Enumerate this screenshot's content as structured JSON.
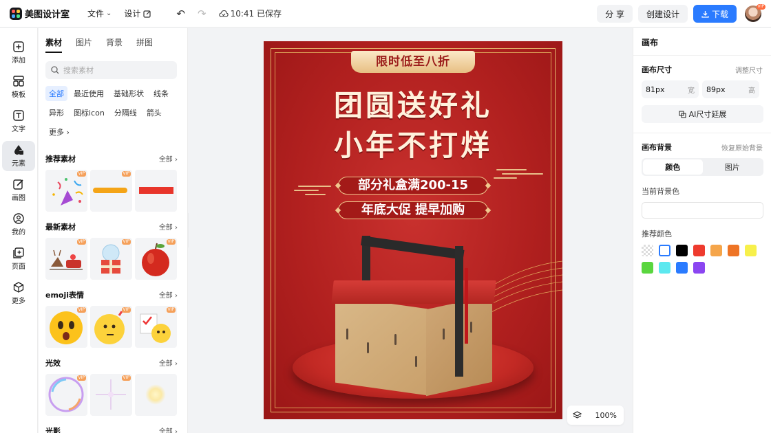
{
  "app": {
    "name": "美图设计室"
  },
  "topbar": {
    "file_menu": "文件",
    "design_menu": "设计",
    "save_status": "10:41 已保存",
    "share_label": "分 享",
    "create_label": "创建设计",
    "download_label": "下载",
    "avatar_badge": "VIP"
  },
  "rail": {
    "items": [
      {
        "label": "添加",
        "icon": "plus-square-icon"
      },
      {
        "label": "模板",
        "icon": "template-icon"
      },
      {
        "label": "文字",
        "icon": "text-icon"
      },
      {
        "label": "元素",
        "icon": "shapes-icon"
      },
      {
        "label": "画图",
        "icon": "pencil-icon"
      },
      {
        "label": "我的",
        "icon": "user-icon"
      },
      {
        "label": "页面",
        "icon": "page-add-icon"
      },
      {
        "label": "更多",
        "icon": "cube-icon"
      }
    ]
  },
  "panel": {
    "tabs": [
      "素材",
      "图片",
      "背景",
      "拼图"
    ],
    "search_placeholder": "搜索素材",
    "chips": [
      "全部",
      "最近使用",
      "基础形状",
      "线条",
      "异形",
      "图标icon",
      "分隔线",
      "箭头",
      "更多"
    ],
    "sections": [
      {
        "title": "推荐素材",
        "all": "全部"
      },
      {
        "title": "最新素材",
        "all": "全部"
      },
      {
        "title": "emoji表情",
        "all": "全部"
      },
      {
        "title": "光效",
        "all": "全部"
      },
      {
        "title": "光影",
        "all": "全部"
      }
    ],
    "vip": "VIP"
  },
  "poster": {
    "banner": "限时低至八折",
    "headline1": "团圆送好礼",
    "headline2": "小年不打烊",
    "pill1": "部分礼盒满200-15",
    "pill2": "年底大促 提早加购"
  },
  "zoom": {
    "value": "100%"
  },
  "right_panel": {
    "title": "画布",
    "canvas_size_label": "画布尺寸",
    "adjust_size": "调整尺寸",
    "width_value": "81px",
    "width_unit": "宽",
    "height_value": "89px",
    "height_unit": "高",
    "ai_extend": "AI尺寸延展",
    "bg_label": "画布背景",
    "restore_bg": "恢复原始背景",
    "seg_color": "颜色",
    "seg_image": "图片",
    "current_bg": "当前背景色",
    "recommended": "推荐颜色",
    "swatches": [
      "transparent",
      "#ffffff",
      "#000000",
      "#ee3b2e",
      "#f5a54a",
      "#ee7425",
      "#f7f04b",
      "#5ad63f",
      "#5ce8ef",
      "#2a7bff",
      "#8b46f1"
    ]
  },
  "colors": {
    "accent": "#2a7bff",
    "poster_red": "#b1201f",
    "gold": "#e4b56b"
  }
}
